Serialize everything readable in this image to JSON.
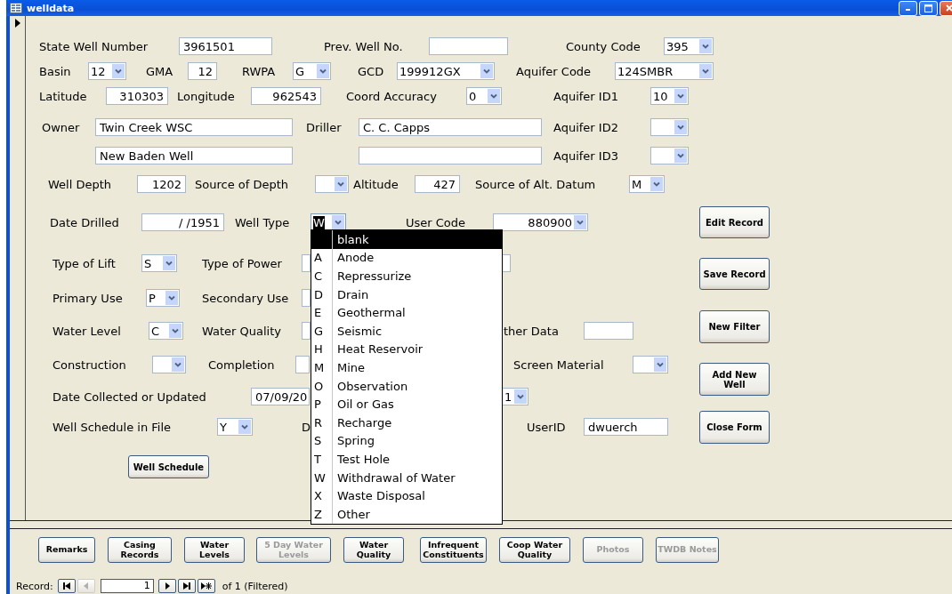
{
  "window": {
    "title": "welldata"
  },
  "form": {
    "rows": [
      {
        "items": [
          {
            "kind": "label",
            "text": "State Well Number"
          },
          {
            "kind": "field",
            "value": "3961501"
          },
          {
            "kind": "label",
            "text": "Prev. Well No."
          },
          {
            "kind": "field"
          },
          {
            "kind": "label",
            "text": "County Code"
          },
          {
            "kind": "combo",
            "value": "395",
            "focused": false
          }
        ]
      },
      {
        "items": [
          {
            "kind": "label",
            "text": "Basin"
          },
          {
            "kind": "combo",
            "value": "12",
            "focused": false
          },
          {
            "kind": "label",
            "text": "GMA"
          },
          {
            "kind": "field",
            "value": "12"
          },
          {
            "kind": "label",
            "text": "RWPA"
          },
          {
            "kind": "combo",
            "value": "G",
            "focused": false
          },
          {
            "kind": "label",
            "text": "GCD"
          },
          {
            "kind": "combo",
            "value": "199912GX",
            "focused": false
          },
          {
            "kind": "label",
            "text": "Aquifer Code"
          },
          {
            "kind": "combo",
            "value": "124SMBR",
            "focused": false
          }
        ]
      },
      {
        "items": [
          {
            "kind": "label",
            "text": "Latitude"
          },
          {
            "kind": "field",
            "value": "310303"
          },
          {
            "kind": "label",
            "text": "Longitude"
          },
          {
            "kind": "field",
            "value": "962543"
          },
          {
            "kind": "label",
            "text": "Coord Accuracy"
          },
          {
            "kind": "combo",
            "value": "0",
            "focused": false
          },
          {
            "kind": "label",
            "text": "Aquifer ID1"
          },
          {
            "kind": "combo",
            "value": "10",
            "focused": false
          }
        ]
      },
      {
        "items": [
          {
            "kind": "label",
            "text": "Owner"
          },
          {
            "kind": "field",
            "value": "Twin Creek WSC"
          },
          {
            "kind": "label",
            "text": "Driller"
          },
          {
            "kind": "field",
            "value": "C. C. Capps"
          },
          {
            "kind": "label",
            "text": "Aquifer ID2"
          },
          {
            "kind": "combo",
            "focused": false
          }
        ]
      },
      {
        "items": [
          {
            "kind": "field",
            "value": "New Baden Well"
          },
          {
            "kind": "field"
          },
          {
            "kind": "label",
            "text": "Aquifer ID3"
          },
          {
            "kind": "combo",
            "focused": false
          }
        ]
      },
      {
        "items": [
          {
            "kind": "label",
            "text": "Well Depth"
          },
          {
            "kind": "field",
            "value": "1202"
          },
          {
            "kind": "label",
            "text": "Source of Depth"
          },
          {
            "kind": "combo",
            "focused": false
          },
          {
            "kind": "label",
            "text": "Altitude"
          },
          {
            "kind": "field",
            "value": "427"
          },
          {
            "kind": "label",
            "text": "Source of Alt. Datum"
          },
          {
            "kind": "combo",
            "value": "M",
            "focused": false
          }
        ]
      },
      {
        "items": [
          {
            "kind": "label",
            "text": "Date Drilled"
          },
          {
            "kind": "field",
            "value": "/ /1951"
          },
          {
            "kind": "label",
            "text": "Well Type"
          },
          {
            "kind": "combo",
            "value": "W",
            "focused": true
          },
          {
            "kind": "label",
            "text": "User Code"
          },
          {
            "kind": "combo",
            "value": "880900",
            "focused": false
          }
        ]
      },
      {
        "items": [
          {
            "kind": "label",
            "text": "Type of Lift"
          },
          {
            "kind": "combo",
            "value": "S",
            "focused": false
          },
          {
            "kind": "label",
            "text": "Type of Power"
          },
          {
            "kind": "field"
          },
          {
            "kind": "field"
          }
        ]
      },
      {
        "items": [
          {
            "kind": "label",
            "text": "Primary Use"
          },
          {
            "kind": "combo",
            "value": "P",
            "focused": false
          },
          {
            "kind": "label",
            "text": "Secondary Use"
          },
          {
            "kind": "field"
          }
        ]
      },
      {
        "items": [
          {
            "kind": "label",
            "text": "Water Level"
          },
          {
            "kind": "combo",
            "value": "C",
            "focused": false
          },
          {
            "kind": "label",
            "text": "Water Quality"
          },
          {
            "kind": "field"
          },
          {
            "kind": "label",
            "text": "ther Data"
          },
          {
            "kind": "field"
          }
        ]
      },
      {
        "items": [
          {
            "kind": "label",
            "text": "Construction"
          },
          {
            "kind": "combo",
            "focused": false
          },
          {
            "kind": "label",
            "text": "Completion"
          },
          {
            "kind": "field"
          },
          {
            "kind": "label",
            "text": "Screen Material"
          },
          {
            "kind": "combo",
            "focused": false
          }
        ]
      },
      {
        "items": [
          {
            "kind": "label",
            "text": "Date Collected or Updated"
          },
          {
            "kind": "field",
            "value": "07/09/20"
          },
          {
            "kind": "combo",
            "value": "1",
            "focused": false
          }
        ]
      },
      {
        "items": [
          {
            "kind": "label",
            "text": "Well Schedule in File"
          },
          {
            "kind": "combo",
            "value": "Y",
            "focused": false
          },
          {
            "kind": "label",
            "text": "D"
          },
          {
            "kind": "label",
            "text": "UserID"
          },
          {
            "kind": "field",
            "value": "dwuerch"
          }
        ]
      }
    ],
    "schedule_button": {
      "label": "Well Schedule"
    },
    "side_buttons": [
      {
        "label": "Edit Record"
      },
      {
        "label": "Save Record"
      },
      {
        "label": "New Filter"
      },
      {
        "label": "Add New Well"
      },
      {
        "label": "Close Form"
      }
    ]
  },
  "well_type_list": {
    "options": [
      {
        "name": "blank",
        "selected": true
      },
      {
        "code": "A",
        "name": "Anode",
        "selected": false
      },
      {
        "code": "C",
        "name": "Repressurize",
        "selected": false
      },
      {
        "code": "D",
        "name": "Drain",
        "selected": false
      },
      {
        "code": "E",
        "name": "Geothermal",
        "selected": false
      },
      {
        "code": "G",
        "name": "Seismic",
        "selected": false
      },
      {
        "code": "H",
        "name": "Heat Reservoir",
        "selected": false
      },
      {
        "code": "M",
        "name": "Mine",
        "selected": false
      },
      {
        "code": "O",
        "name": "Observation",
        "selected": false
      },
      {
        "code": "P",
        "name": "Oil or Gas",
        "selected": false
      },
      {
        "code": "R",
        "name": "Recharge",
        "selected": false
      },
      {
        "code": "S",
        "name": "Spring",
        "selected": false
      },
      {
        "code": "T",
        "name": "Test Hole",
        "selected": false
      },
      {
        "code": "W",
        "name": "Withdrawal of Water",
        "selected": false
      },
      {
        "code": "X",
        "name": "Waste Disposal",
        "selected": false
      },
      {
        "code": "Z",
        "name": "Other",
        "selected": false
      }
    ]
  },
  "footer_buttons": [
    {
      "label": "Remarks",
      "disabled": false
    },
    {
      "label": "Casing Records",
      "disabled": false
    },
    {
      "label": "Water Levels",
      "disabled": false
    },
    {
      "label": "5 Day Water Levels",
      "disabled": true
    },
    {
      "label": "Water Quality",
      "disabled": false
    },
    {
      "label": "Infrequent Constituents",
      "disabled": false
    },
    {
      "label": "Coop Water Quality",
      "disabled": false
    },
    {
      "label": "Photos",
      "disabled": true
    },
    {
      "label": "TWDB Notes",
      "disabled": true
    }
  ],
  "record_nav": {
    "label": "Record:",
    "buttons": [
      {
        "kind": "first",
        "disabled": false
      },
      {
        "kind": "prev",
        "disabled": true
      }
    ],
    "current": "1",
    "buttons_after": [
      {
        "kind": "next",
        "disabled": false
      },
      {
        "kind": "last",
        "disabled": false
      },
      {
        "kind": "new",
        "disabled": false
      }
    ],
    "total": "of  1 (Filtered)"
  }
}
